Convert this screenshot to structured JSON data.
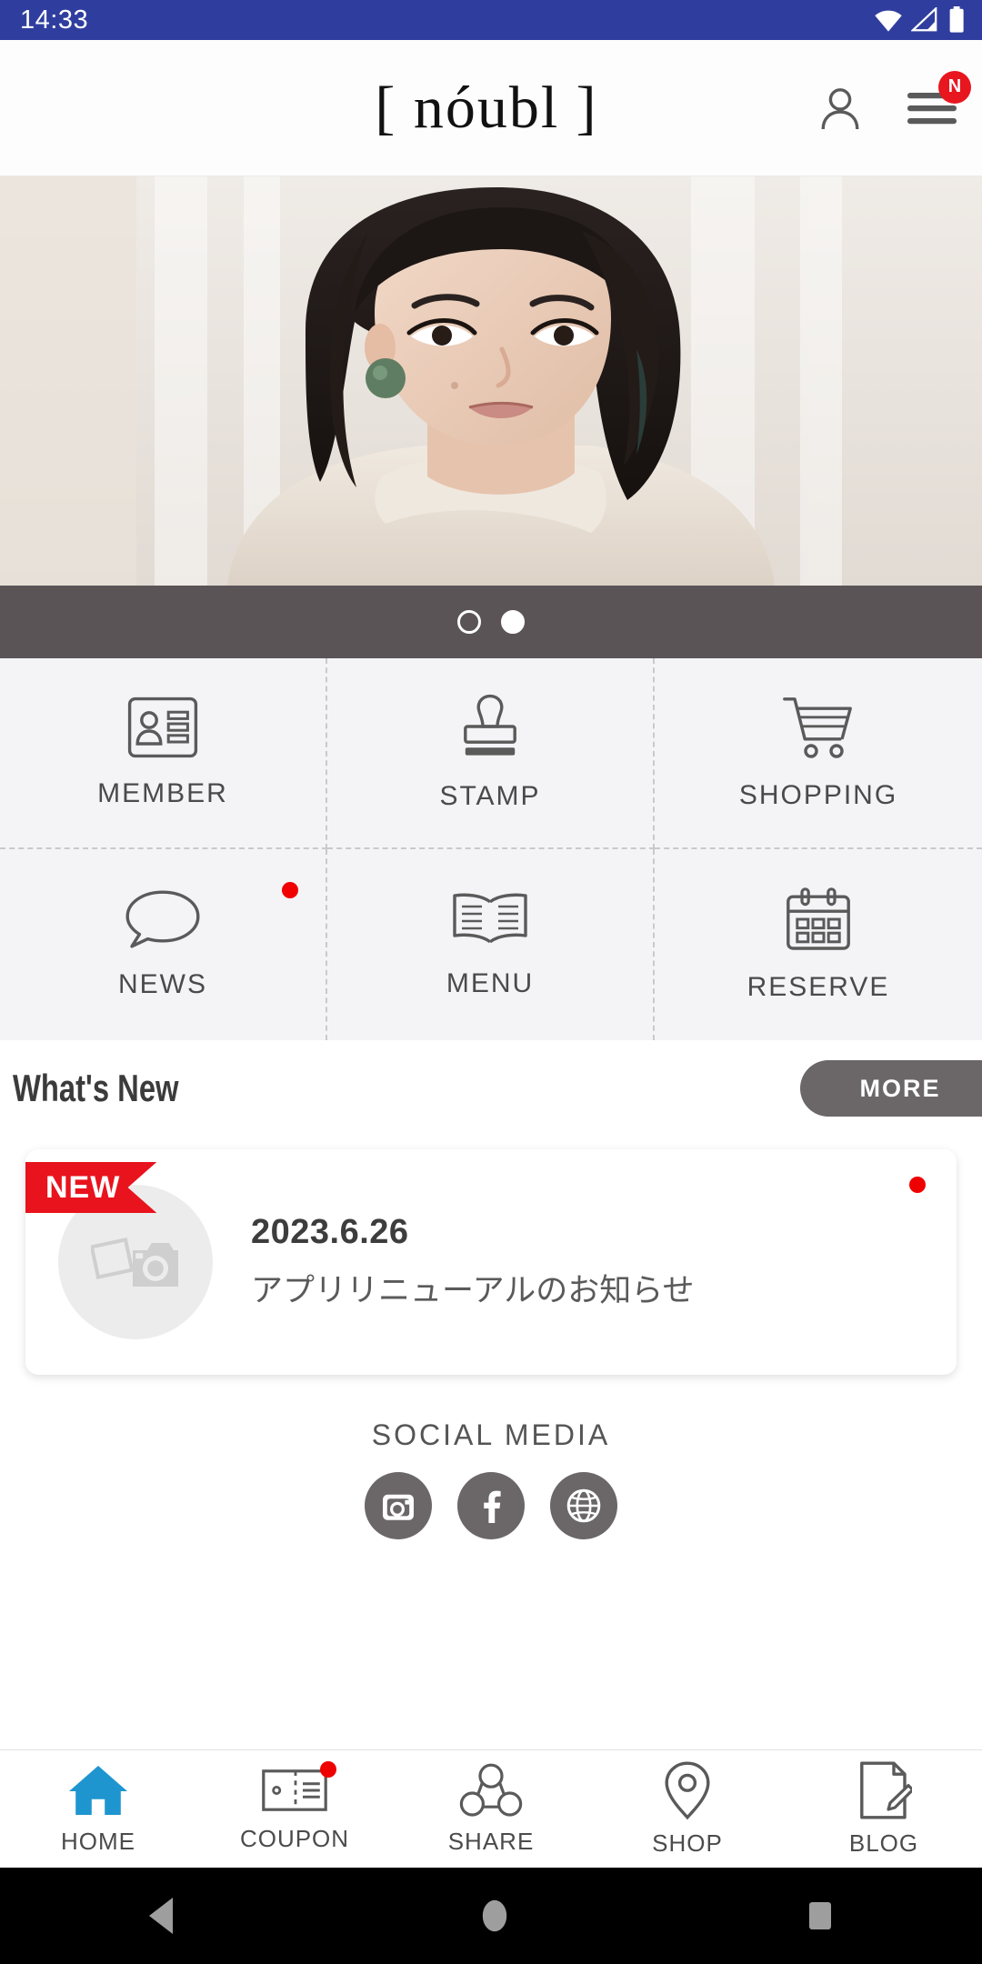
{
  "status_bar": {
    "time": "14:33",
    "icons": [
      "wifi-icon",
      "cellular-signal-icon",
      "battery-icon"
    ],
    "background": "#2f3e9e"
  },
  "header": {
    "logo": "[ nóubl ]",
    "account_icon": "person-icon",
    "menu_icon": "hamburger-menu-icon",
    "menu_badge": "N",
    "badge_color": "#e8161f"
  },
  "hero": {
    "alt": "model-portrait-photo",
    "carousel": {
      "total": 2,
      "active_index": 1
    }
  },
  "grid": {
    "items": [
      {
        "label": "MEMBER",
        "icon": "id-card-icon",
        "dot": false
      },
      {
        "label": "STAMP",
        "icon": "rubber-stamp-icon",
        "dot": false
      },
      {
        "label": "SHOPPING",
        "icon": "shopping-cart-icon",
        "dot": false
      },
      {
        "label": "NEWS",
        "icon": "speech-bubble-icon",
        "dot": true
      },
      {
        "label": "MENU",
        "icon": "open-book-icon",
        "dot": false
      },
      {
        "label": "RESERVE",
        "icon": "calendar-icon",
        "dot": false
      }
    ]
  },
  "whats_new": {
    "title": "What's New",
    "more_label": "MORE",
    "items": [
      {
        "ribbon": "NEW",
        "date": "2023.6.26",
        "title": "アプリリニューアルのお知らせ",
        "thumbnail": "photo-placeholder-icon",
        "unread": true
      }
    ]
  },
  "social_media": {
    "title": "SOCIAL MEDIA",
    "links": [
      {
        "name": "instagram-icon"
      },
      {
        "name": "facebook-icon"
      },
      {
        "name": "website-globe-icon"
      }
    ]
  },
  "bottom_nav": {
    "active": "HOME",
    "accent_color": "#1f95cf",
    "items": [
      {
        "label": "HOME",
        "icon": "home-icon",
        "active": true,
        "dot": false
      },
      {
        "label": "COUPON",
        "icon": "coupon-icon",
        "active": false,
        "dot": true
      },
      {
        "label": "SHARE",
        "icon": "share-nodes-icon",
        "active": false,
        "dot": false
      },
      {
        "label": "SHOP",
        "icon": "map-pin-icon",
        "active": false,
        "dot": false
      },
      {
        "label": "BLOG",
        "icon": "document-pen-icon",
        "active": false,
        "dot": false
      }
    ]
  },
  "android_nav": {
    "back": "back-triangle-icon",
    "home": "home-circle-icon",
    "recents": "recents-square-icon"
  }
}
